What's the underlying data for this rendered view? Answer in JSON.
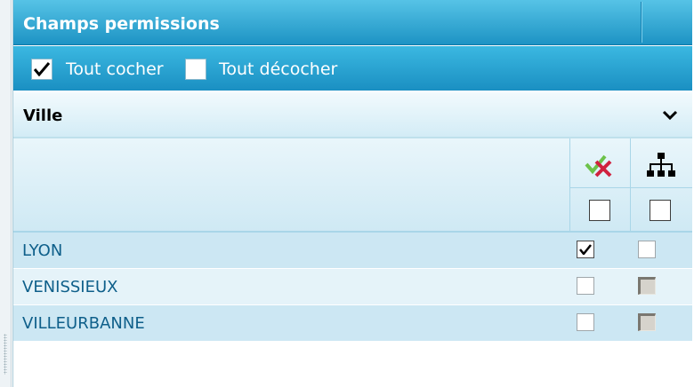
{
  "panel": {
    "title": "Champs permissions"
  },
  "toolbar": {
    "check_all": {
      "label": "Tout cocher",
      "checked": true
    },
    "uncheck_all": {
      "label": "Tout décocher",
      "checked": false
    }
  },
  "group": {
    "title": "Ville",
    "expanded": true
  },
  "columns": [
    {
      "icon": "check-cross-icon",
      "all_checked": false
    },
    {
      "icon": "hierarchy-icon",
      "all_checked": false
    }
  ],
  "rows": [
    {
      "label": "LYON",
      "cells": [
        {
          "checked": true,
          "disabled": false
        },
        {
          "checked": false,
          "disabled": false
        }
      ]
    },
    {
      "label": "VENISSIEUX",
      "cells": [
        {
          "checked": false,
          "disabled": false
        },
        {
          "checked": false,
          "disabled": true
        }
      ]
    },
    {
      "label": "VILLEURBANNE",
      "cells": [
        {
          "checked": false,
          "disabled": false
        },
        {
          "checked": false,
          "disabled": true
        }
      ]
    }
  ],
  "colors": {
    "header_blue": "#1d93c4",
    "row_text": "#0e5f8a",
    "row_odd": "#cce7f3",
    "row_even": "#e5f3f9"
  }
}
